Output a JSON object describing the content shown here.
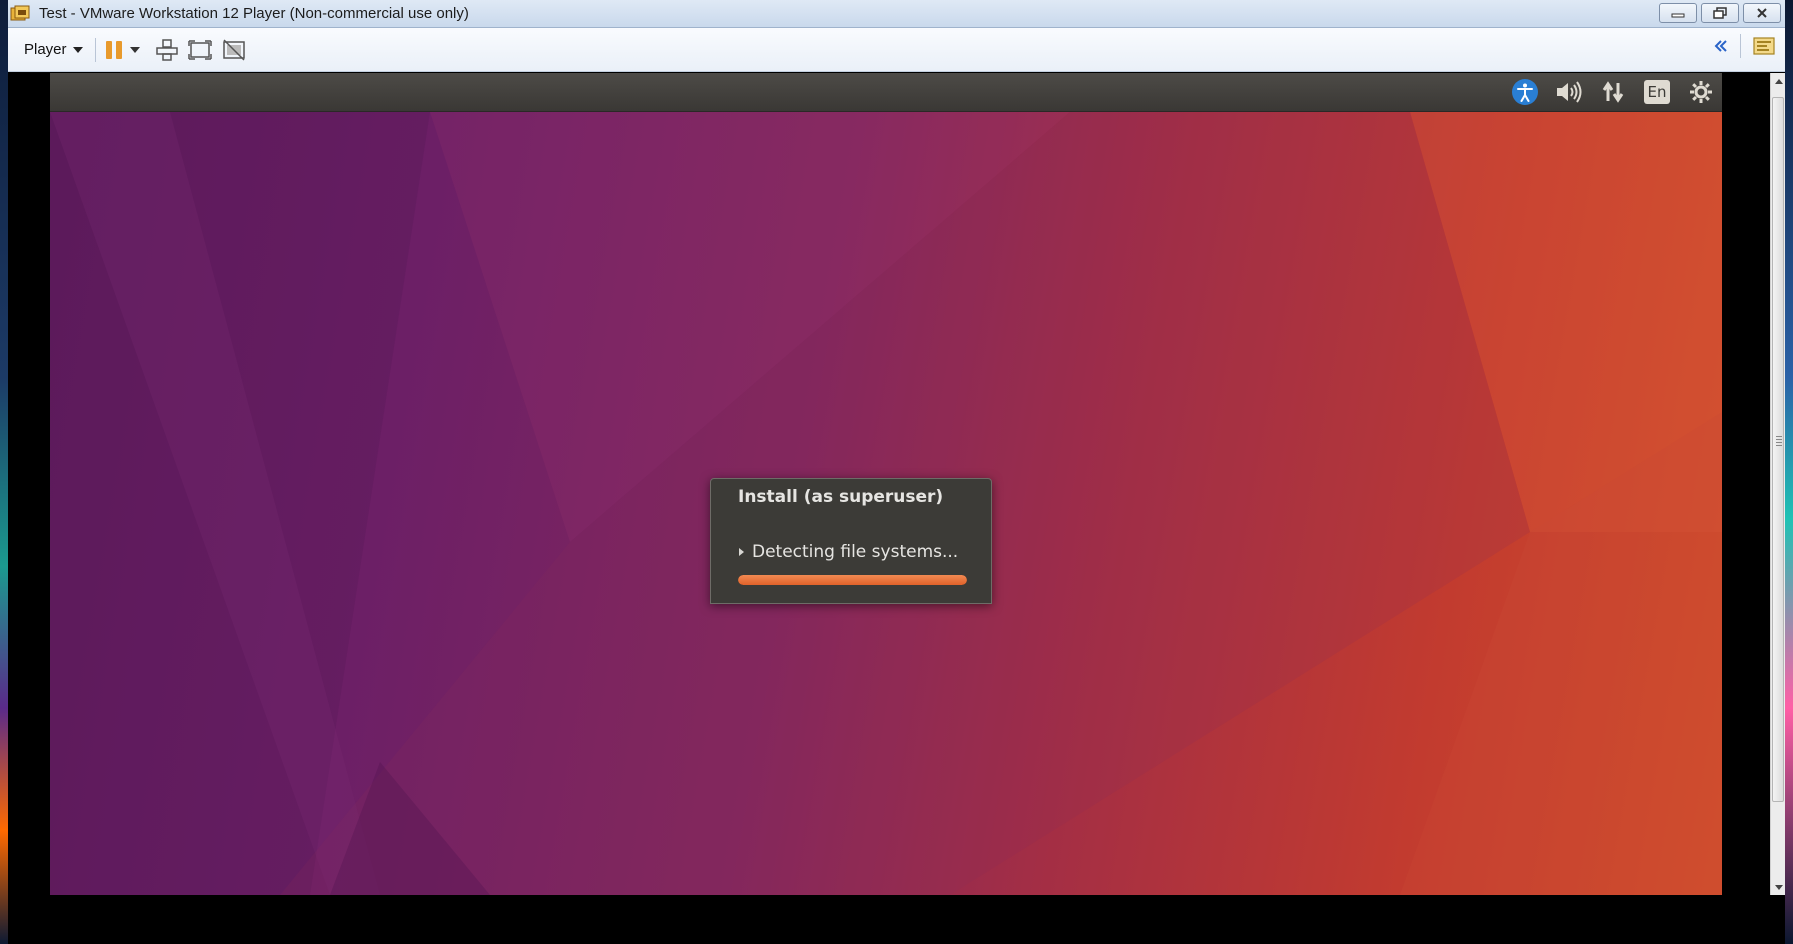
{
  "window": {
    "title": "Test - VMware Workstation 12 Player (Non-commercial use only)",
    "controls": [
      "minimize-icon",
      "restore-icon",
      "close-icon"
    ]
  },
  "toolbar": {
    "player_label": "Player",
    "buttons": [
      "pause-icon",
      "dropdown-arrow-icon",
      "send-ctrl-alt-del-icon",
      "fullscreen-icon",
      "unity-icon"
    ],
    "right_buttons": [
      "collapse-chevron-icon",
      "library-icon"
    ]
  },
  "guest": {
    "indicators": {
      "accessibility": "accessibility-icon",
      "sound": "sound-icon",
      "network": "network-icon",
      "keyboard_label": "En",
      "settings": "gear-icon"
    },
    "dialog": {
      "title": "Install (as superuser)",
      "status": "Detecting file systems...",
      "progress_percent": 100
    }
  },
  "colors": {
    "accent_orange": "#e0622a",
    "accessibility_blue": "#2a7fd4"
  }
}
